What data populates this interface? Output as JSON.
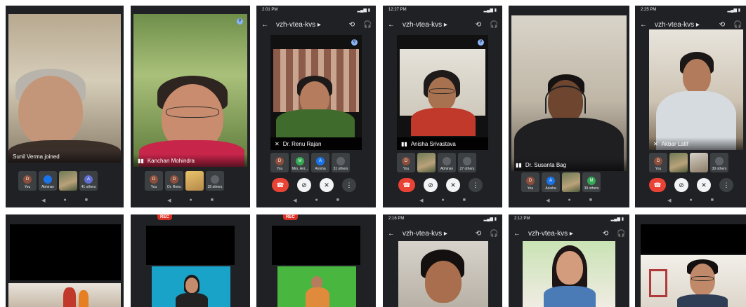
{
  "header": {
    "meeting_title": "vzh-vtea-kvs",
    "chevron": "▸"
  },
  "status_times": {
    "p3": "2:01 PM",
    "p4": "12:27 PM",
    "p6": "2:25 PM",
    "p10": "2:16 PM",
    "p11": "2:12 PM"
  },
  "captions": {
    "p1": "Sunil Verma joined",
    "p2": "Kanchan Mohindra",
    "p3": "Dr. Renu Rajan",
    "p4": "Anisha Srivastava",
    "p5": "Dr. Susanta Bag",
    "p6": "Akbar Latif"
  },
  "participants": {
    "p1": [
      {
        "initial": "D",
        "label": "You"
      },
      {
        "initial": "",
        "label": "Abhinav"
      },
      {
        "initial": "",
        "label": ""
      },
      {
        "initial": "A",
        "label": "41 others"
      }
    ],
    "p2": [
      {
        "initial": "D",
        "label": "You"
      },
      {
        "initial": "D",
        "label": "Dr. Renu"
      },
      {
        "initial": "",
        "label": ""
      },
      {
        "initial": "",
        "label": "35 others"
      }
    ],
    "p3": [
      {
        "initial": "D",
        "label": "You"
      },
      {
        "initial": "M",
        "label": "Mrs. Ani..."
      },
      {
        "initial": "A",
        "label": "Anisha"
      },
      {
        "initial": "",
        "label": "31 others"
      }
    ],
    "p4": [
      {
        "initial": "D",
        "label": "You"
      },
      {
        "initial": "",
        "label": ""
      },
      {
        "initial": "",
        "label": "Abhinav"
      },
      {
        "initial": "",
        "label": "27 others"
      }
    ],
    "p5": [
      {
        "initial": "D",
        "label": "You"
      },
      {
        "initial": "A",
        "label": "Anisha"
      },
      {
        "initial": "",
        "label": ""
      },
      {
        "initial": "M",
        "label": "39 others"
      }
    ],
    "p6": [
      {
        "initial": "D",
        "label": "You"
      },
      {
        "initial": "",
        "label": ""
      },
      {
        "initial": "",
        "label": ""
      },
      {
        "initial": "",
        "label": "30 others"
      }
    ]
  },
  "rec_label": "REC",
  "icons": {
    "back": "←",
    "flip": "⟲",
    "audio": "🎧",
    "end": "☎",
    "cam_off": "⊘",
    "mic_off": "✕",
    "more": "⋮",
    "nav_back": "◀",
    "nav_home": "●",
    "nav_recent": "■",
    "pin": "⚲",
    "mic_muted": "✕",
    "talking": "▮▮"
  },
  "colors": {
    "accent_blue": "#8ab4f8",
    "end_call": "#ea4335",
    "dark_bg": "#202124"
  }
}
